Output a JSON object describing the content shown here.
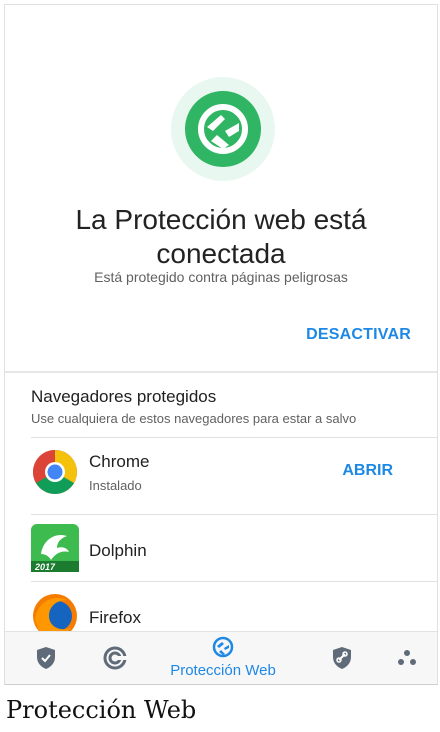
{
  "status": {
    "title_line1": "La Protección web está",
    "title_line2": "conectada",
    "subtitle": "Está protegido contra páginas peligrosas",
    "deactivate_label": "DESACTIVAR"
  },
  "browsers": {
    "section_title": "Navegadores protegidos",
    "section_desc": "Use cualquiera de estos navegadores para estar a salvo",
    "items": [
      {
        "name": "Chrome",
        "status": "Instalado",
        "action": "ABRIR",
        "icon": "chrome-icon"
      },
      {
        "name": "Dolphin",
        "badge": "2017",
        "icon": "dolphin-icon"
      },
      {
        "name": "Firefox",
        "icon": "firefox-icon"
      }
    ]
  },
  "bottom_nav": {
    "active_label": "Protección Web",
    "items": [
      "shield-check-icon",
      "refresh-icon",
      "web-protection-icon",
      "link-shield-icon",
      "more-dots-icon"
    ]
  },
  "caption": "Protección Web",
  "colors": {
    "accent_blue": "#1e88e5",
    "brand_green": "#2fb563",
    "hero_bg": "#e8f7ef",
    "icon_gray": "#5f6b78"
  }
}
